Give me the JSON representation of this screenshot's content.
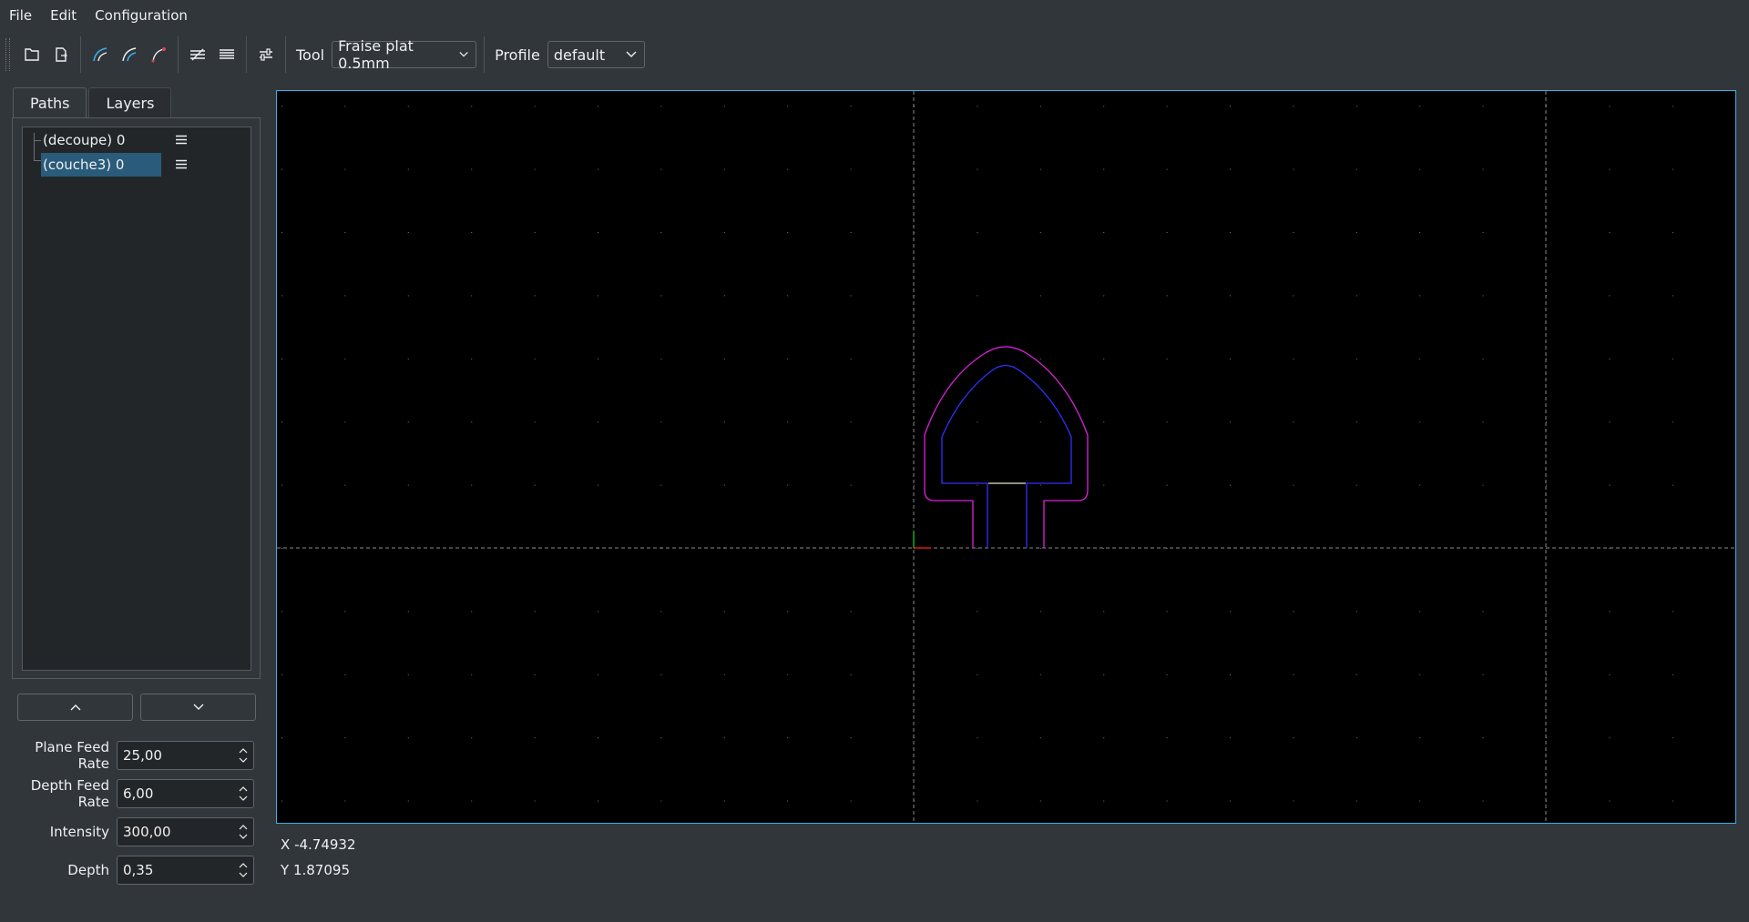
{
  "menu": {
    "file": "File",
    "edit": "Edit",
    "configuration": "Configuration"
  },
  "toolbar": {
    "icons": [
      "open-file-icon",
      "export-file-icon",
      "arc-tool-icon",
      "arc-tool-2-icon",
      "arc-tool-3-icon",
      "pocket-icon",
      "lines-icon",
      "settings-sliders-icon"
    ],
    "tool_label": "Tool",
    "tool_value": "Fraise plat 0.5mm",
    "profile_label": "Profile",
    "profile_value": "default"
  },
  "tabs": {
    "paths": "Paths",
    "layers": "Layers"
  },
  "paths": [
    {
      "label": "(decoupe) 0",
      "selected": false
    },
    {
      "label": "(couche3) 0",
      "selected": true
    }
  ],
  "fields": {
    "plane_feed_rate": {
      "label": "Plane Feed Rate",
      "value": "25,00"
    },
    "depth_feed_rate": {
      "label": "Depth Feed Rate",
      "value": "6,00"
    },
    "intensity": {
      "label": "Intensity",
      "value": "300,00"
    },
    "depth": {
      "label": "Depth",
      "value": "0,35"
    }
  },
  "status": {
    "x_label": "X",
    "x_value": "-4.74932",
    "y_label": "Y",
    "y_value": "1.87095"
  },
  "colors": {
    "accent": "#3daee9",
    "outer_path": "#e020e0",
    "inner_path": "#3030ff",
    "selection": "#2a5b7a"
  }
}
